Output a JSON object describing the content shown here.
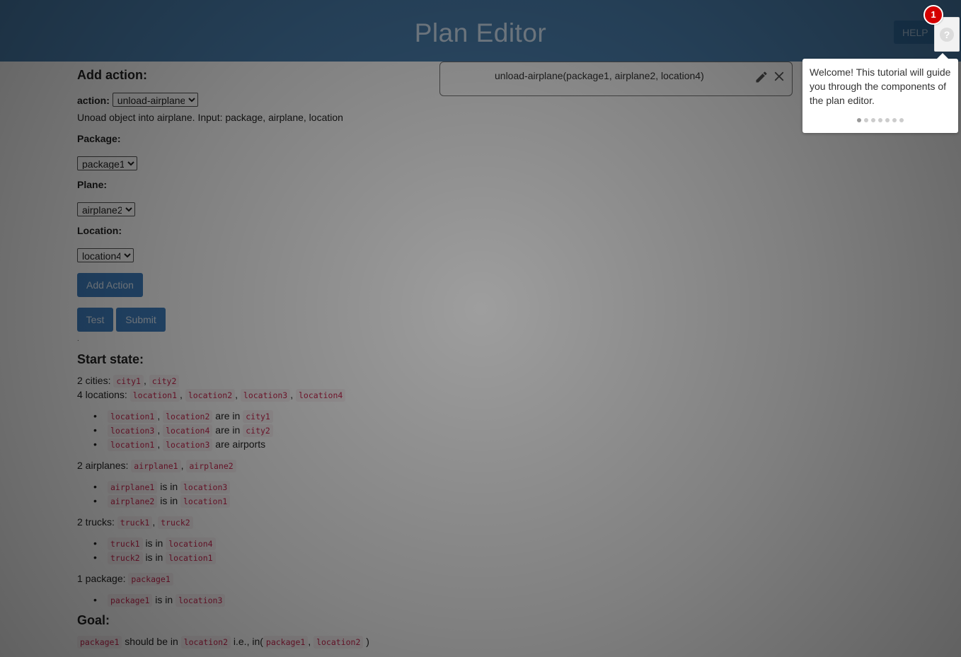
{
  "header": {
    "title": "Plan Editor",
    "help_label": "HELP",
    "badge_count": "1",
    "help_icon": "?"
  },
  "add_action": {
    "heading": "Add action:",
    "action_label": "action:",
    "action_value": "unload-airplane",
    "description": "Unoad object into airplane. Input: package, airplane, location",
    "package_label": "Package:",
    "package_value": "package1",
    "plane_label": "Plane:",
    "plane_value": "airplane2",
    "location_label": "Location:",
    "location_value": "location4",
    "add_button": "Add Action",
    "test_button": "Test",
    "submit_button": "Submit",
    "dot": "."
  },
  "plan": {
    "steps": [
      {
        "text": "unload-airplane(package1, airplane2, location4)"
      }
    ]
  },
  "start_state": {
    "heading": "Start state:",
    "cities_prefix": "2 cities:",
    "cities": [
      "city1",
      "city2"
    ],
    "locations_prefix": "4 locations:",
    "locations": [
      "location1",
      "location2",
      "location3",
      "location4"
    ],
    "location_facts": [
      {
        "items": [
          "location1",
          "location2"
        ],
        "text": "are in",
        "target": "city1"
      },
      {
        "items": [
          "location3",
          "location4"
        ],
        "text": "are in",
        "target": "city2"
      },
      {
        "items": [
          "location1",
          "location3"
        ],
        "text": "are airports",
        "target": ""
      }
    ],
    "airplanes_prefix": "2 airplanes:",
    "airplanes": [
      "airplane1",
      "airplane2"
    ],
    "airplane_facts": [
      {
        "item": "airplane1",
        "text": "is in",
        "target": "location3"
      },
      {
        "item": "airplane2",
        "text": "is in",
        "target": "location1"
      }
    ],
    "trucks_prefix": "2 trucks:",
    "trucks": [
      "truck1",
      "truck2"
    ],
    "truck_facts": [
      {
        "item": "truck1",
        "text": "is in",
        "target": "location4"
      },
      {
        "item": "truck2",
        "text": "is in",
        "target": "location1"
      }
    ],
    "packages_prefix": "1 package:",
    "packages": [
      "package1"
    ],
    "package_facts": [
      {
        "item": "package1",
        "text": "is in",
        "target": "location3"
      }
    ]
  },
  "goal": {
    "heading": "Goal:",
    "item": "package1",
    "text1": "should be in",
    "target": "location2",
    "text2": "i.e., in(",
    "args": [
      "package1",
      "location2"
    ],
    "close": ")"
  },
  "tutorial": {
    "text": "Welcome! This tutorial will guide you through the components of the plan editor.",
    "pages": 7,
    "current_page": 1
  }
}
